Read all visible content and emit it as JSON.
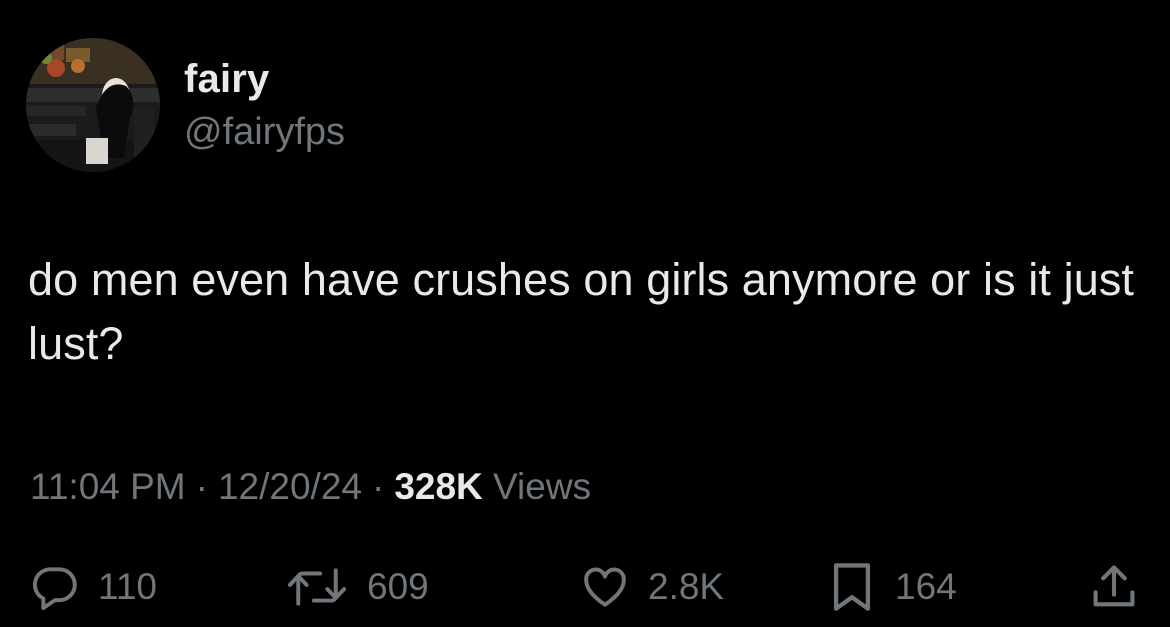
{
  "author": {
    "display_name": "fairy",
    "handle": "@fairyfps"
  },
  "tweet": {
    "text": "do men even have crushes on girls anymore or is it just lust?"
  },
  "meta": {
    "time": "11:04 PM",
    "separator": "·",
    "date": "12/20/24",
    "views_count": "328K",
    "views_label": "Views"
  },
  "actions": {
    "replies": "110",
    "reposts": "609",
    "likes": "2.8K",
    "bookmarks": "164"
  },
  "colors": {
    "background": "#000000",
    "primary_text": "#e7e9ea",
    "secondary_text": "#71767b"
  },
  "icons": [
    "reply-icon",
    "repost-icon",
    "like-icon",
    "bookmark-icon",
    "share-icon"
  ]
}
